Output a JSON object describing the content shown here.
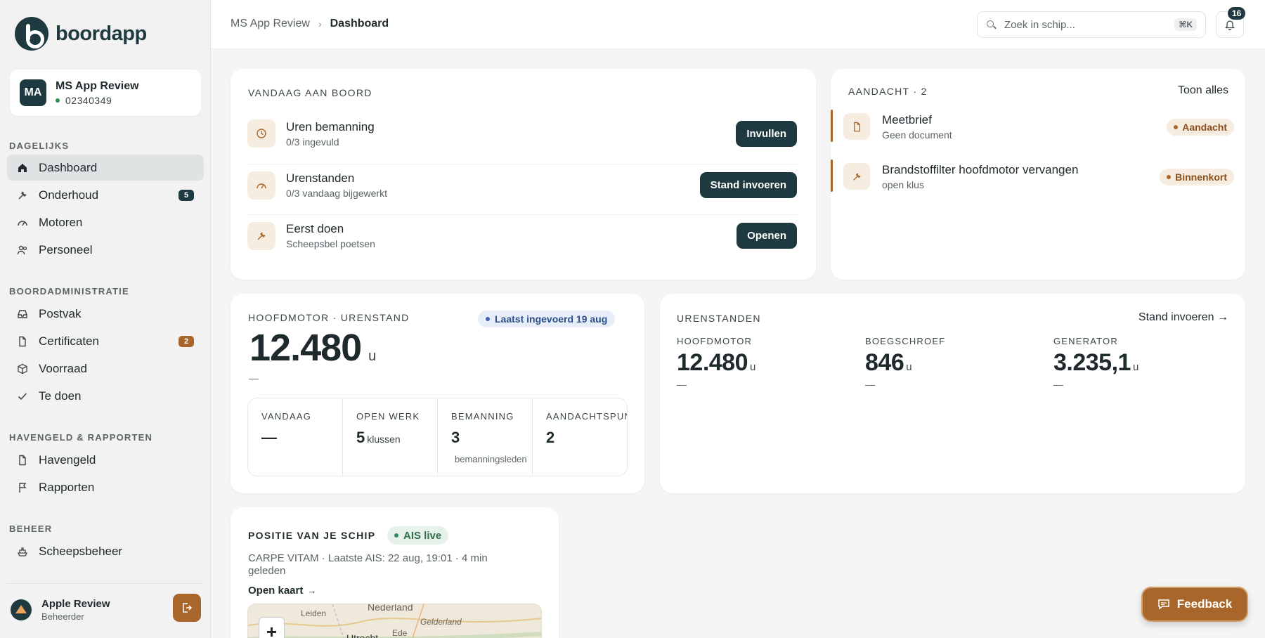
{
  "brand": {
    "name": "boordapp"
  },
  "ship": {
    "initials": "MA",
    "name": "MS App Review",
    "code": "02340349"
  },
  "nav": {
    "sections": {
      "daily": "DAGELIJKS",
      "admin": "BOORDADMINISTRATIE",
      "harbour": "HAVENGELD & RAPPORTEN",
      "manage": "BEHEER"
    },
    "items": {
      "dashboard": "Dashboard",
      "onderhoud": "Onderhoud",
      "onderhoud_badge": "5",
      "motoren": "Motoren",
      "personeel": "Personeel",
      "postvak": "Postvak",
      "certificaten": "Certificaten",
      "certificaten_badge": "2",
      "voorraad": "Voorraad",
      "tedoen": "Te doen",
      "havengeld": "Havengeld",
      "rapporten": "Rapporten",
      "scheepsbeheer": "Scheepsbeheer"
    }
  },
  "user": {
    "name": "Apple Review",
    "role": "Beheerder"
  },
  "topbar": {
    "breadcrumb_root": "MS App Review",
    "breadcrumb_sep": "›",
    "breadcrumb_current": "Dashboard",
    "search_placeholder": "Zoek in schip...",
    "shortcut": "⌘K",
    "notifications": "16"
  },
  "today": {
    "title": "VANDAAG AAN BOORD",
    "rows": [
      {
        "title": "Uren bemanning",
        "sub": "0/3 ingevuld",
        "action": "Invullen"
      },
      {
        "title": "Urenstanden",
        "sub": "0/3 vandaag bijgewerkt",
        "action": "Stand invoeren"
      },
      {
        "title": "Eerst doen",
        "sub": "Scheepsbel poetsen",
        "action": "Openen"
      }
    ]
  },
  "attention": {
    "title": "AANDACHT · 2",
    "show_all": "Toon alles",
    "items": [
      {
        "title": "Meetbrief",
        "sub": "Geen document",
        "badge": "Aandacht"
      },
      {
        "title": "Brandstoffilter hoofdmotor vervangen",
        "sub": "open klus",
        "badge": "Binnenkort"
      }
    ]
  },
  "main_engine": {
    "title": "HOOFDMOTOR · URENSTAND",
    "pill": "Laatst ingevoerd 19 aug",
    "value": "12.480",
    "unit": "u",
    "dash": "—",
    "stats": [
      {
        "label": "VANDAAG",
        "value": "—",
        "unit": "",
        "sub": ""
      },
      {
        "label": "OPEN WERK",
        "value": "5",
        "unit": "klussen",
        "sub": ""
      },
      {
        "label": "BEMANNING",
        "value": "3",
        "unit": "",
        "sub": "bemanningsleden"
      },
      {
        "label": "AANDACHTSPUNTEN",
        "value": "2",
        "unit": "",
        "sub": ""
      }
    ]
  },
  "hours": {
    "title": "URENSTANDEN",
    "action": "Stand invoeren →",
    "items": [
      {
        "label": "HOOFDMOTOR",
        "value": "12.480",
        "unit": "u",
        "dash": "—"
      },
      {
        "label": "BOEGSCHROEF",
        "value": "846",
        "unit": "u",
        "dash": "—"
      },
      {
        "label": "GENERATOR",
        "value": "3.235,1",
        "unit": "u",
        "dash": "—"
      }
    ]
  },
  "position": {
    "title": "POSITIE VAN JE SCHIP",
    "pill": "AIS live",
    "info": "CARPE VITAM · Laatste AIS: 22 aug, 19:01 · 4 min geleden",
    "open_map": "Open kaart",
    "map_labels": [
      "Nederland",
      "Leiden",
      "Gelderland",
      "Utrecht",
      "Ede"
    ],
    "zoom_in": "+"
  },
  "feedback": {
    "label": "Feedback"
  },
  "colors": {
    "primary": "#1e3a40",
    "accent": "#a8662a",
    "background": "#f4f5f4"
  }
}
